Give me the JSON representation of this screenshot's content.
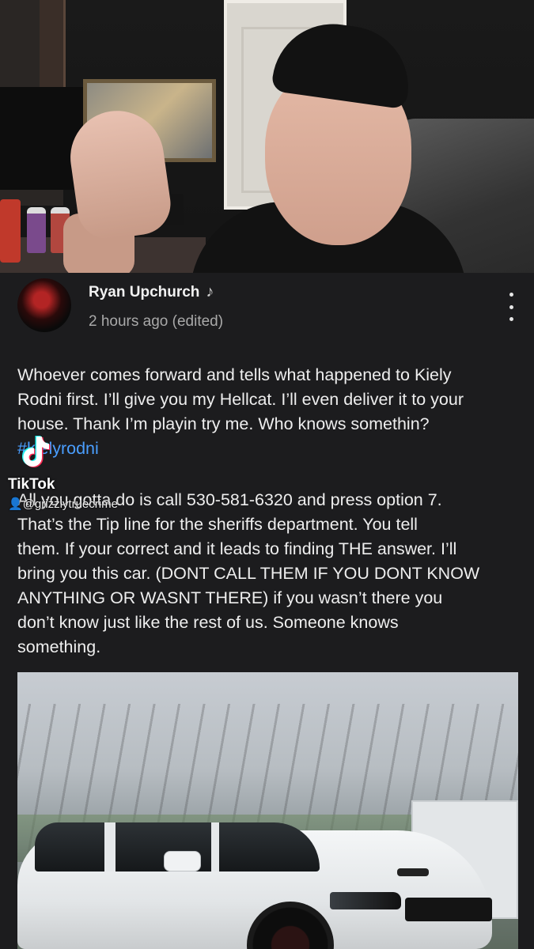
{
  "post": {
    "author": "Ryan Upchurch",
    "timestamp": "2 hours ago (edited)",
    "paragraph1_lines": "Whoever comes forward and tells what happened to Kiely\nRodni first. I’ll give you my Hellcat. I’ll even deliver it to your\nhouse. Thank I’m playin try me.  Who knows somethin?",
    "hashtag": "#kielyrodni",
    "paragraph2_lines": "All you gotta do is call 530-581-6320 and press option 7.\nThat’s the Tip line for the sheriffs department. You tell\nthem. If your correct and it leads to finding THE answer.  I’ll\nbring you this car.  (DONT CALL THEM IF YOU DONT KNOW\nANYTHING OR WASNT THERE) if you wasn’t there you\ndon’t know just like the rest of us. Someone knows\nsomething."
  },
  "icons": {
    "author_badge": "music-note-icon",
    "menu": "more-vertical-icon",
    "watermark": "tiktok-logo-icon",
    "watermark_user": "user-icon"
  },
  "watermark": {
    "brand": "TikTok",
    "user": "@grizzlytruecrime"
  },
  "colors": {
    "background": "#1c1c1e",
    "hashtag": "#4a9eff",
    "text": "#eeeeee",
    "meta": "#a9a9a9"
  }
}
